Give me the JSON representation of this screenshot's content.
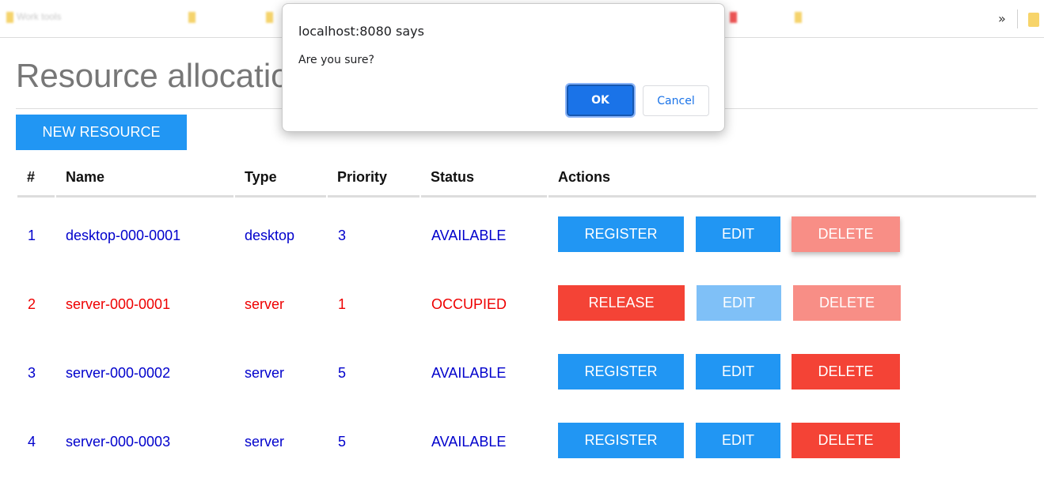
{
  "bookmarks": {
    "items": [
      "Work tools",
      "",
      "",
      "",
      "",
      ""
    ],
    "more_label": "»"
  },
  "page": {
    "title": "Resource allocatio",
    "new_button_label": "NEW RESOURCE"
  },
  "table": {
    "headers": [
      "#",
      "Name",
      "Type",
      "Priority",
      "Status",
      "Actions"
    ],
    "rows": [
      {
        "id": "1",
        "name": "desktop-000-0001",
        "type": "desktop",
        "priority": "3",
        "status": "AVAILABLE",
        "primary_action": "REGISTER",
        "edit_label": "EDIT",
        "delete_label": "DELETE"
      },
      {
        "id": "2",
        "name": "server-000-0001",
        "type": "server",
        "priority": "1",
        "status": "OCCUPIED",
        "primary_action": "RELEASE",
        "edit_label": "EDIT",
        "delete_label": "DELETE"
      },
      {
        "id": "3",
        "name": "server-000-0002",
        "type": "server",
        "priority": "5",
        "status": "AVAILABLE",
        "primary_action": "REGISTER",
        "edit_label": "EDIT",
        "delete_label": "DELETE"
      },
      {
        "id": "4",
        "name": "server-000-0003",
        "type": "server",
        "priority": "5",
        "status": "AVAILABLE",
        "primary_action": "REGISTER",
        "edit_label": "EDIT",
        "delete_label": "DELETE"
      }
    ]
  },
  "dialog": {
    "origin": "localhost:8080 says",
    "message": "Are you sure?",
    "ok_label": "OK",
    "cancel_label": "Cancel"
  },
  "colors": {
    "primary_blue": "#2196f3",
    "danger_red": "#f44336",
    "available_text": "#0000cc",
    "occupied_text": "#ee0000",
    "dialog_ok": "#1a73e8"
  }
}
